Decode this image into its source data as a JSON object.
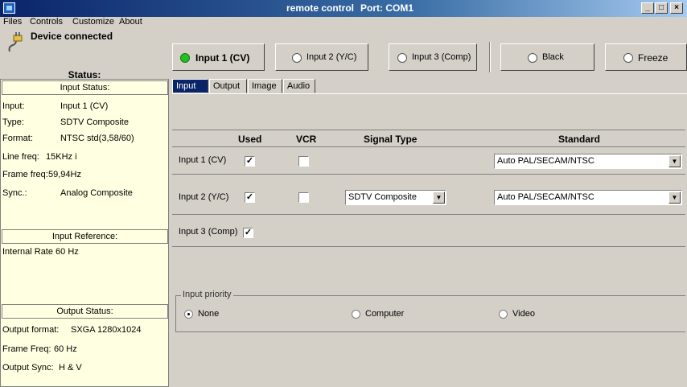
{
  "window": {
    "title": "remote control",
    "port": "Port: COM1",
    "minimize": "_",
    "maximize": "□",
    "close": "×"
  },
  "menu": [
    {
      "label": "Files"
    },
    {
      "label": "Controls"
    },
    {
      "label": "Customize"
    },
    {
      "label": "About"
    }
  ],
  "device": {
    "status": "Device connected",
    "icon": "plug-icon"
  },
  "status_title": "Status:",
  "input_status": {
    "header": "Input Status:",
    "rows": [
      {
        "label": "Input:",
        "value": "Input 1 (CV)"
      },
      {
        "label": "Type:",
        "value": "SDTV Composite"
      },
      {
        "label": "Format:",
        "value": "NTSC std(3,58/60)"
      },
      {
        "label": "Line freq:",
        "value": "15KHz i"
      },
      {
        "label": "Frame freq:",
        "value": "59,94Hz"
      },
      {
        "label": "Sync.:",
        "value": "Analog Composite"
      }
    ]
  },
  "input_reference": {
    "header": "Input Reference:",
    "value": "Internal Rate 60 Hz"
  },
  "output_status": {
    "header": "Output Status:",
    "rows": [
      {
        "label": "Output format:",
        "value": "SXGA  1280x1024"
      },
      {
        "label": "Frame Freq:",
        "value": "60 Hz"
      },
      {
        "label": "Output Sync:",
        "value": "H & V"
      }
    ]
  },
  "source_buttons": [
    {
      "label": "Input 1 (CV)",
      "selected": true
    },
    {
      "label": "Input 2 (Y/C)",
      "selected": false
    },
    {
      "label": "Input 3 (Comp)",
      "selected": false
    },
    {
      "label": "Black",
      "selected": false
    },
    {
      "label": "Freeze",
      "selected": false
    }
  ],
  "tabs": [
    {
      "label": "Input",
      "active": true
    },
    {
      "label": "Output",
      "active": false
    },
    {
      "label": "Image",
      "active": false
    },
    {
      "label": "Audio",
      "active": false
    }
  ],
  "grid": {
    "headers": {
      "used": "Used",
      "vcr": "VCR",
      "signal_type": "Signal Type",
      "standard": "Standard"
    },
    "rows": [
      {
        "label": "Input 1 (CV)",
        "used": true,
        "vcr": false,
        "signal_type": "",
        "standard": "Auto PAL/SECAM/NTSC"
      },
      {
        "label": "Input 2 (Y/C)",
        "used": true,
        "vcr": false,
        "signal_type": "SDTV Composite",
        "standard": "Auto PAL/SECAM/NTSC"
      },
      {
        "label": "Input 3 (Comp)",
        "used": true
      }
    ]
  },
  "priority": {
    "legend": "Input priority",
    "options": [
      {
        "label": "None",
        "selected": true
      },
      {
        "label": "Computer",
        "selected": false
      },
      {
        "label": "Video",
        "selected": false
      }
    ]
  }
}
